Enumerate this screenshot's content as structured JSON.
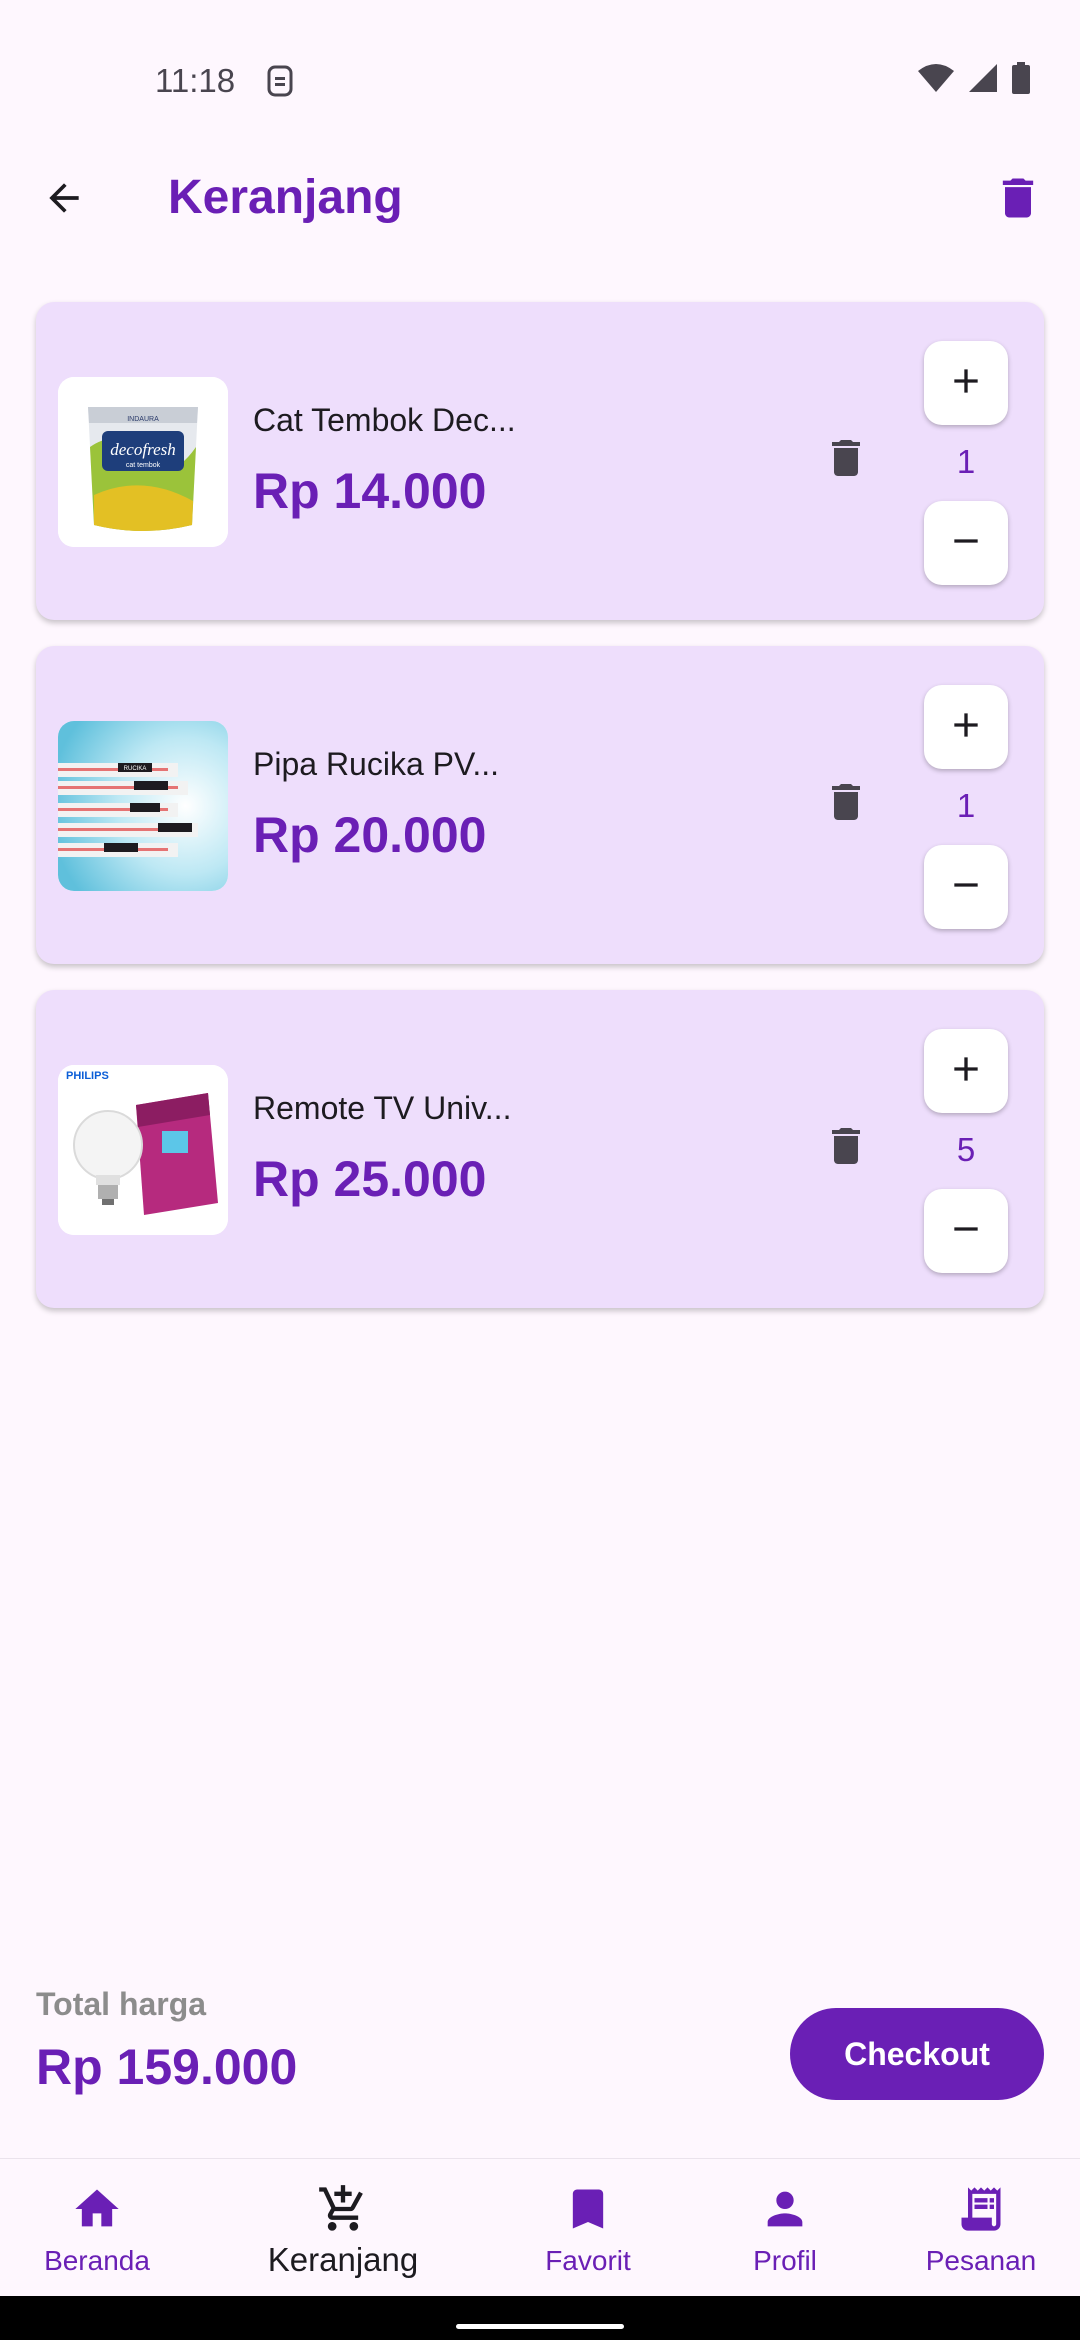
{
  "status_bar": {
    "time": "11:18",
    "icons": [
      "sim-icon",
      "wifi-icon",
      "signal-icon",
      "battery-icon"
    ]
  },
  "app_bar": {
    "title": "Keranjang",
    "back_icon": "arrow-back-icon",
    "clear_icon": "trash-icon"
  },
  "cart": {
    "items": [
      {
        "name": "Cat Tembok Dec...",
        "price": "Rp 14.000",
        "quantity": "1",
        "image": "paint-bucket-image"
      },
      {
        "name": "Pipa Rucika PV...",
        "price": "Rp 20.000",
        "quantity": "1",
        "image": "pvc-pipes-image"
      },
      {
        "name": "Remote TV Univ...",
        "price": "Rp 25.000",
        "quantity": "5",
        "image": "philips-bulb-image"
      }
    ],
    "image_text": {
      "paint_brand_top": "INDAURA",
      "paint_brand": "decofresh",
      "paint_sub": "cat tembok",
      "pipe_brand": "RUCIKA",
      "bulb_brand": "PHILIPS"
    }
  },
  "summary": {
    "total_label": "Total harga",
    "total_value": "Rp 159.000",
    "checkout_label": "Checkout"
  },
  "nav": {
    "items": [
      {
        "label": "Beranda",
        "icon": "home-icon"
      },
      {
        "label": "Keranjang",
        "icon": "cart-add-icon"
      },
      {
        "label": "Favorit",
        "icon": "bookmark-icon"
      },
      {
        "label": "Profil",
        "icon": "person-icon"
      },
      {
        "label": "Pesanan",
        "icon": "receipt-icon"
      }
    ],
    "active": "Keranjang"
  },
  "colors": {
    "accent": "#6A1FB5",
    "card_background": "#EEDEFC",
    "page_background": "#FEF7FE",
    "total_label": "#8C8C8C"
  }
}
